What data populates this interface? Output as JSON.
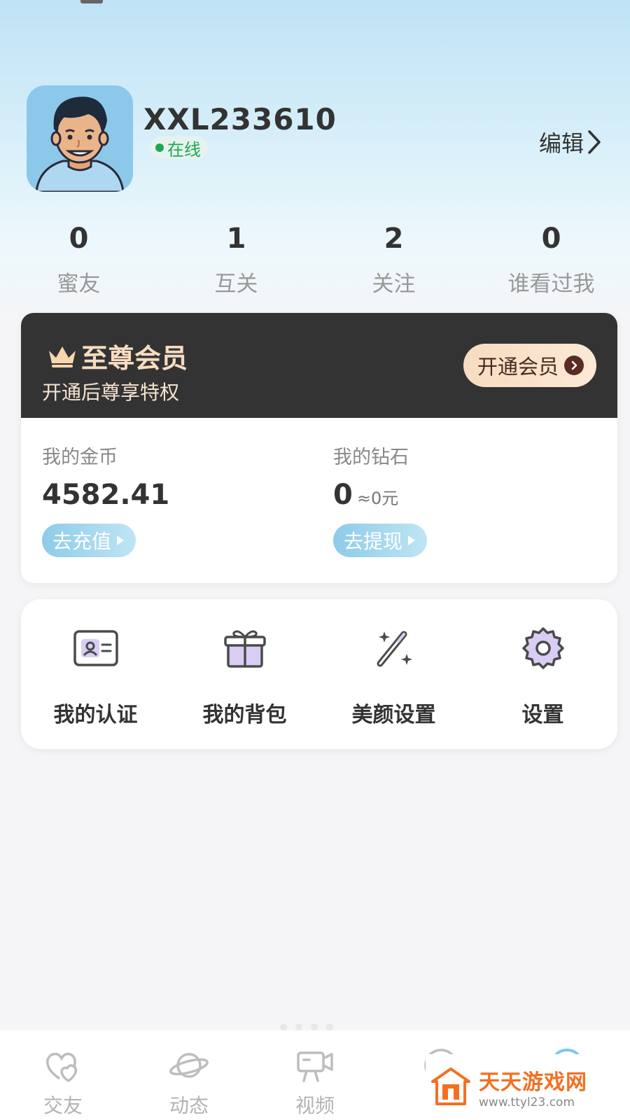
{
  "profile": {
    "username": "XXL233610",
    "status": "在线",
    "edit_label": "编辑"
  },
  "stats": [
    {
      "value": "0",
      "label": "蜜友"
    },
    {
      "value": "1",
      "label": "互关"
    },
    {
      "value": "2",
      "label": "关注"
    },
    {
      "value": "0",
      "label": "谁看过我"
    }
  ],
  "vip": {
    "title": "至尊会员",
    "subtitle": "开通后尊享特权",
    "button_label": "开通会员"
  },
  "wallet": {
    "coins_label": "我的金币",
    "coins_value": "4582.41",
    "recharge_label": "去充值",
    "diamonds_label": "我的钻石",
    "diamonds_value": "0",
    "diamonds_approx": "≈0元",
    "withdraw_label": "去提现"
  },
  "actions": [
    {
      "label": "我的认证",
      "icon": "id-card-icon"
    },
    {
      "label": "我的背包",
      "icon": "gift-icon"
    },
    {
      "label": "美颜设置",
      "icon": "magic-wand-icon"
    },
    {
      "label": "设置",
      "icon": "gear-icon"
    }
  ],
  "tabbar": [
    {
      "label": "交友",
      "icon": "hearts-icon"
    },
    {
      "label": "动态",
      "icon": "planet-icon"
    },
    {
      "label": "视频",
      "icon": "video-camera-icon"
    },
    {
      "label": "",
      "icon": "message-icon"
    },
    {
      "label": "",
      "icon": "profile-icon"
    }
  ],
  "watermark": {
    "title": "天天游戏网",
    "url": "www.ttyl23.com"
  },
  "colors": {
    "online": "#1fa84f",
    "vip_bg": "#333333",
    "vip_gold": "#f6dcc0",
    "wallet_button": "#8ecbe8",
    "watermark_orange": "#f37022"
  }
}
